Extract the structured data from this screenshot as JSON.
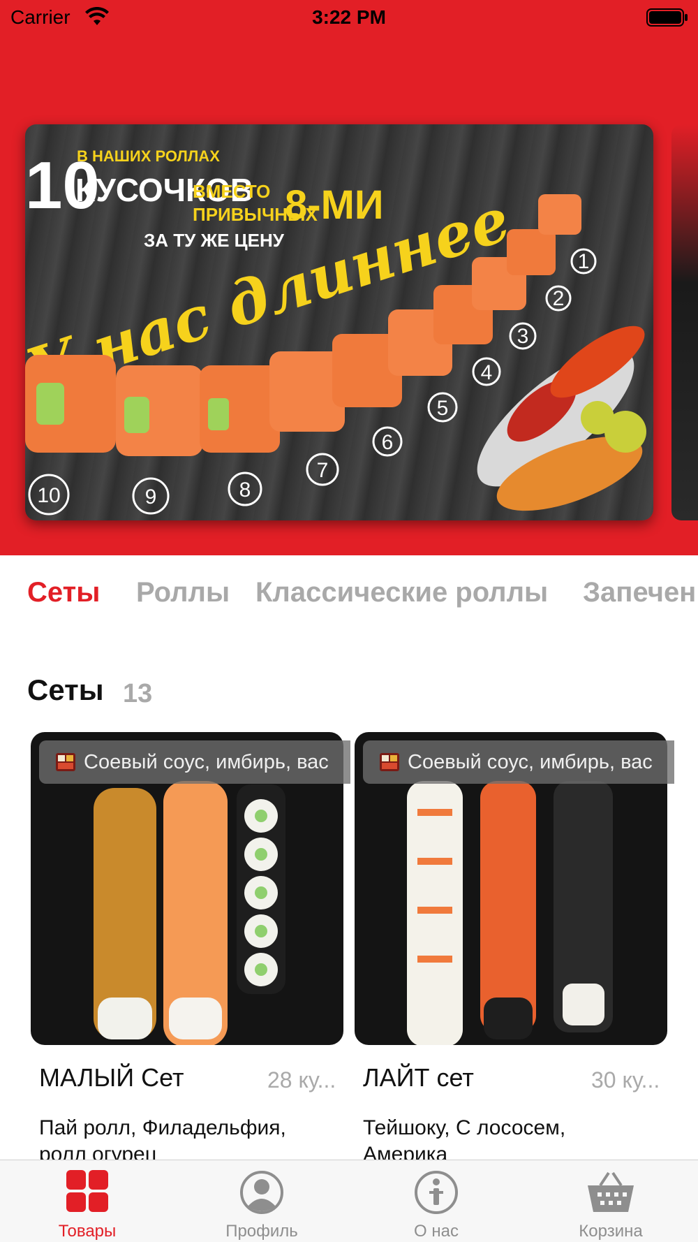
{
  "status_bar": {
    "carrier": "Carrier",
    "time": "3:22 PM"
  },
  "banner": {
    "line_small_top": "В НАШИХ РОЛЛАХ",
    "big_number": "10",
    "line_pieces": "КУСОЧКОВ",
    "line_instead": "ВМЕСТО",
    "line_usual": "ПРИВЫЧНЫХ",
    "line_eight": "8-МИ",
    "line_same_price": "ЗА ТУ ЖЕ ЦЕНУ",
    "script_text": "У нас длиннее",
    "roll_numbers": [
      "10",
      "9",
      "8",
      "7",
      "6",
      "5",
      "4",
      "3",
      "2",
      "1"
    ]
  },
  "categories": [
    {
      "label": "Сеты",
      "active": true
    },
    {
      "label": "Роллы",
      "active": false
    },
    {
      "label": "Классические роллы",
      "active": false
    },
    {
      "label": "Запечен",
      "active": false
    }
  ],
  "section": {
    "title": "Сеты",
    "count": "13"
  },
  "products": [
    {
      "tag": "Соевый соус, имбирь, вас",
      "name": "МАЛЫЙ Сет",
      "pieces": "28 ку...",
      "desc": "Пай ролл, Филадельфия, ролл огурец"
    },
    {
      "tag": "Соевый соус, имбирь, вас",
      "name": "ЛАЙТ сет",
      "pieces": "30 ку...",
      "desc": "Тейшоку, С лососем, Америка"
    }
  ],
  "tab_bar": [
    {
      "label": "Товары",
      "icon": "grid-icon",
      "active": true
    },
    {
      "label": "Профиль",
      "icon": "profile-icon",
      "active": false
    },
    {
      "label": "О нас",
      "icon": "info-icon",
      "active": false
    },
    {
      "label": "Корзина",
      "icon": "basket-icon",
      "active": false
    }
  ],
  "colors": {
    "accent": "#e21f26",
    "inactive": "#a9a9a9",
    "tab_inactive": "#8e8e8e"
  }
}
